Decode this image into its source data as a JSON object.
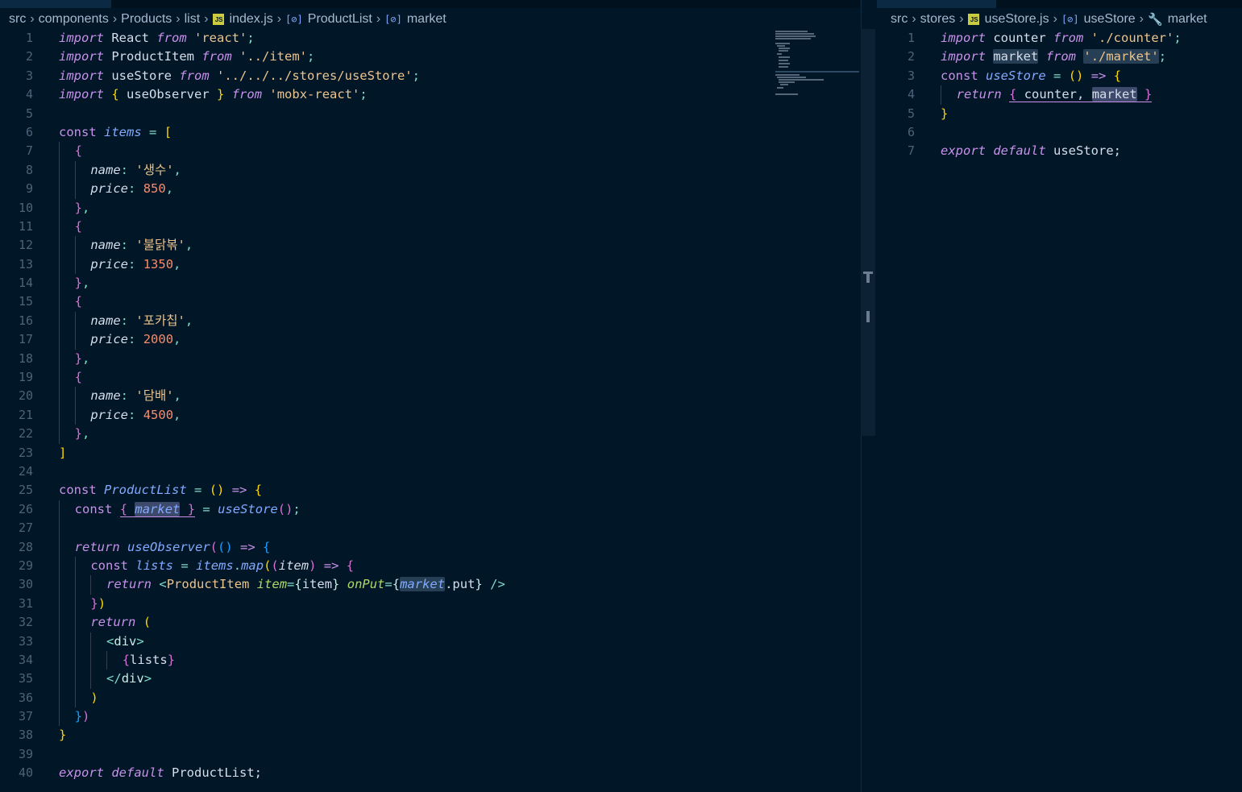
{
  "left_editor": {
    "breadcrumb": [
      "src",
      "components",
      "Products",
      "list",
      "index.js",
      "ProductList",
      "market"
    ],
    "lines": [
      {
        "n": "1"
      },
      {
        "n": "2"
      },
      {
        "n": "3"
      },
      {
        "n": "4"
      },
      {
        "n": "5"
      },
      {
        "n": "6"
      },
      {
        "n": "7"
      },
      {
        "n": "8"
      },
      {
        "n": "9"
      },
      {
        "n": "10"
      },
      {
        "n": "11"
      },
      {
        "n": "12"
      },
      {
        "n": "13"
      },
      {
        "n": "14"
      },
      {
        "n": "15"
      },
      {
        "n": "16"
      },
      {
        "n": "17"
      },
      {
        "n": "18"
      },
      {
        "n": "19"
      },
      {
        "n": "20"
      },
      {
        "n": "21"
      },
      {
        "n": "22"
      },
      {
        "n": "23"
      },
      {
        "n": "24"
      },
      {
        "n": "25"
      },
      {
        "n": "26"
      },
      {
        "n": "27"
      },
      {
        "n": "28"
      },
      {
        "n": "29"
      },
      {
        "n": "30"
      },
      {
        "n": "31"
      },
      {
        "n": "32"
      },
      {
        "n": "33"
      },
      {
        "n": "34"
      },
      {
        "n": "35"
      },
      {
        "n": "36"
      },
      {
        "n": "37"
      },
      {
        "n": "38"
      },
      {
        "n": "39"
      },
      {
        "n": "40"
      }
    ],
    "tokens": {
      "import": "import",
      "from": "from",
      "const": "const",
      "return": "return",
      "export": "export",
      "default": "default",
      "react_id": " React ",
      "react_str": "'react'",
      "productitem_id": " ProductItem ",
      "item_str": "'../item'",
      "usestore_id": " useStore ",
      "usestore_str": "'../../../stores/useStore'",
      "useobserver_id": " useObserver ",
      "mobx_str": "'mobx-react'",
      "items": "items",
      "name": "name",
      "price": "price",
      "n1": "'생수'",
      "p1": "850",
      "n2": "'불닭볶'",
      "p2": "1350",
      "n3": "'포카칩'",
      "p3": "2000",
      "n4": "'담배'",
      "p4": "4500",
      "productlist": "ProductList",
      "market": "market",
      "usestore_call": "useStore",
      "useobserver_call": "useObserver",
      "lists": "lists",
      "map": "map",
      "item": "item",
      "productitem_tag": "ProductItem",
      "item_attr": "item",
      "item_val": "item",
      "onput_attr": "onPut",
      "put": ".put",
      "div": "div",
      "lists_val": "lists",
      "productlist_export": " ProductList;"
    }
  },
  "right_editor": {
    "breadcrumb": [
      "src",
      "stores",
      "useStore.js",
      "useStore",
      "market"
    ],
    "lines": [
      {
        "n": "1"
      },
      {
        "n": "2"
      },
      {
        "n": "3"
      },
      {
        "n": "4"
      },
      {
        "n": "5"
      },
      {
        "n": "6"
      },
      {
        "n": "7"
      }
    ],
    "tokens": {
      "import": "import",
      "from": "from",
      "const": "const",
      "return": "return",
      "export": "export",
      "default": "default",
      "counter_id": " counter ",
      "counter_str": "'./counter'",
      "market_id": "market",
      "market_str": "'./market'",
      "usestore": "useStore",
      "counter": " counter, ",
      "market": "market",
      "usestore_export": " useStore;"
    }
  },
  "icons": [
    "chevron-right-icon",
    "js-file-icon",
    "symbol-variable-icon",
    "wrench-icon"
  ],
  "theme": {
    "background": "#011627",
    "keyword": "#c792ea",
    "string": "#ecc48d",
    "number": "#f78c6c",
    "function": "#82aaff"
  }
}
